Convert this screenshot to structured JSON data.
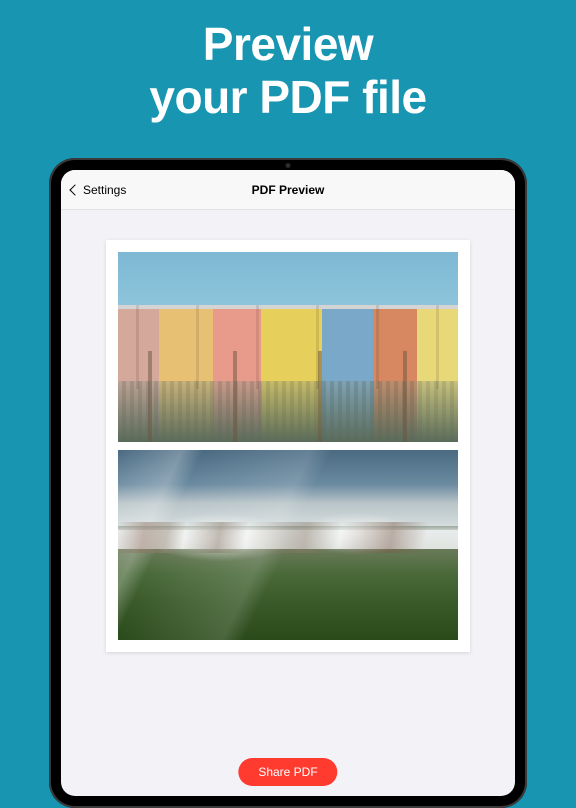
{
  "headline": {
    "line1": "Preview",
    "line2": "your PDF file"
  },
  "navbar": {
    "back_label": "Settings",
    "title": "PDF Preview"
  },
  "actions": {
    "share_label": "Share PDF"
  }
}
